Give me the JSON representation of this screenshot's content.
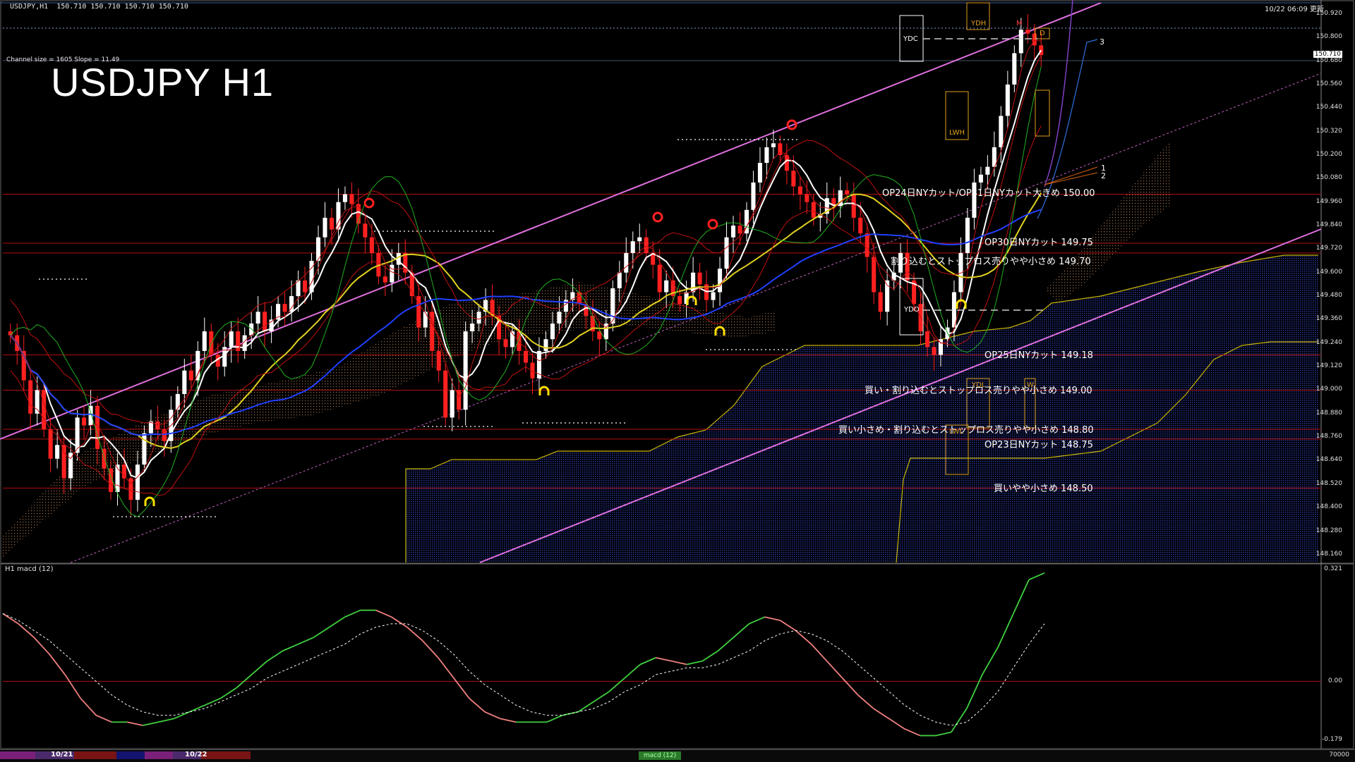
{
  "chart_data": {
    "type": "candlestick",
    "symbol": "USDJPY",
    "timeframe": "H1",
    "title": "USDJPY H1",
    "header_text": "USDJPY,H1  150.710 150.710 150.710 150.710",
    "update_time": "10/22 06:09 更新",
    "channel_info": "Channel size = 1605 Slope = 11.49",
    "current_price": "150.710",
    "current_price_sub": "150.680",
    "price_ticks": [
      "150.920",
      "150.800",
      "150.560",
      "150.440",
      "150.320",
      "150.200",
      "150.080",
      "149.960",
      "149.840",
      "149.720",
      "149.600",
      "149.480",
      "149.360",
      "149.240",
      "149.120",
      "149.000",
      "148.880",
      "148.760",
      "148.640",
      "148.520",
      "148.400",
      "148.280",
      "148.160"
    ],
    "price_range": [
      148.12,
      150.97
    ],
    "candle_closes": [
      149.28,
      149.2,
      149.05,
      148.88,
      149.0,
      148.8,
      148.65,
      148.72,
      148.55,
      148.68,
      148.86,
      148.82,
      148.92,
      148.7,
      148.6,
      148.48,
      148.62,
      148.55,
      148.44,
      148.62,
      148.78,
      148.84,
      148.8,
      148.74,
      148.9,
      148.98,
      149.1,
      149.05,
      149.2,
      149.3,
      149.18,
      149.12,
      149.22,
      149.3,
      149.2,
      149.28,
      149.34,
      149.4,
      149.3,
      149.36,
      149.44,
      149.4,
      149.48,
      149.56,
      149.5,
      149.66,
      149.78,
      149.88,
      149.82,
      149.96,
      150.0,
      149.95,
      149.85,
      149.78,
      149.7,
      149.58,
      149.55,
      149.64,
      149.7,
      149.6,
      149.48,
      149.32,
      149.4,
      149.2,
      149.1,
      148.86,
      149.0,
      148.9,
      149.3,
      149.34,
      149.4,
      149.46,
      149.38,
      149.26,
      149.22,
      149.3,
      149.2,
      149.14,
      149.06,
      149.2,
      149.26,
      149.34,
      149.4,
      149.46,
      149.5,
      149.44,
      149.38,
      149.3,
      149.26,
      149.34,
      149.52,
      149.6,
      149.7,
      149.76,
      149.78,
      149.7,
      149.64,
      149.5,
      149.56,
      149.48,
      149.44,
      149.5,
      149.6,
      149.54,
      149.46,
      149.5,
      149.62,
      149.78,
      149.84,
      149.8,
      149.92,
      150.06,
      150.16,
      150.24,
      150.26,
      150.2,
      150.12,
      150.04,
      150.0,
      149.96,
      149.88,
      149.9,
      149.98,
      149.94,
      150.02,
      150.0,
      149.88,
      149.8,
      149.68,
      149.5,
      149.4,
      149.56,
      149.6,
      149.7,
      149.56,
      149.44,
      149.3,
      149.22,
      149.18,
      149.26,
      149.32,
      149.5,
      149.7,
      149.88,
      150.06,
      150.1,
      150.14,
      150.24,
      150.4,
      150.56,
      150.72,
      150.84,
      150.82,
      150.76,
      150.71
    ],
    "levels": [
      {
        "price": 150.0,
        "label": "OP24日NYカット/OP31日NYカット大きめ 150.00"
      },
      {
        "price": 149.75,
        "label": "OP30日NYカット 149.75"
      },
      {
        "price": 149.7,
        "label": "割り込むとストップロス売りやや小さめ 149.70"
      },
      {
        "price": 149.18,
        "label": "OP25日NYカット 149.18"
      },
      {
        "price": 149.0,
        "label": "買い・割り込むとストップロス売りやや小さめ 149.00"
      },
      {
        "price": 148.8,
        "label": "買い小さめ・割り込むとストップロス売りやや小さめ 148.80"
      },
      {
        "price": 148.75,
        "label": "OP23日NYカット 148.75"
      },
      {
        "price": 148.5,
        "label": "買いやや小さめ 148.50"
      }
    ],
    "box_labels": [
      "YDC",
      "YDH",
      "YDL",
      "YDO",
      "LWH",
      "LWL",
      "W",
      "M",
      "D"
    ],
    "projection_labels": [
      "3",
      "1",
      "2"
    ],
    "macd": {
      "label": "H1  macd (12)",
      "ticks": [
        "0.321",
        "0.00",
        "-0.179"
      ],
      "range": [
        -0.19,
        0.33
      ],
      "main": [
        0.2,
        0.17,
        0.13,
        0.08,
        0.02,
        -0.05,
        -0.1,
        -0.12,
        -0.12,
        -0.13,
        -0.12,
        -0.11,
        -0.09,
        -0.07,
        -0.05,
        -0.02,
        0.02,
        0.06,
        0.09,
        0.11,
        0.13,
        0.16,
        0.19,
        0.21,
        0.21,
        0.19,
        0.16,
        0.12,
        0.07,
        0.01,
        -0.05,
        -0.09,
        -0.11,
        -0.12,
        -0.12,
        -0.12,
        -0.1,
        -0.09,
        -0.06,
        -0.03,
        0.01,
        0.05,
        0.07,
        0.06,
        0.05,
        0.06,
        0.09,
        0.13,
        0.17,
        0.19,
        0.18,
        0.15,
        0.11,
        0.06,
        0.01,
        -0.04,
        -0.08,
        -0.11,
        -0.14,
        -0.16,
        -0.16,
        -0.15,
        -0.08,
        0.02,
        0.1,
        0.2,
        0.3,
        0.32
      ],
      "signal": [
        0.2,
        0.18,
        0.15,
        0.12,
        0.08,
        0.04,
        0.0,
        -0.04,
        -0.07,
        -0.09,
        -0.1,
        -0.1,
        -0.09,
        -0.08,
        -0.06,
        -0.04,
        -0.02,
        0.01,
        0.03,
        0.05,
        0.07,
        0.09,
        0.11,
        0.14,
        0.16,
        0.17,
        0.17,
        0.15,
        0.12,
        0.08,
        0.03,
        -0.01,
        -0.04,
        -0.07,
        -0.09,
        -0.1,
        -0.1,
        -0.09,
        -0.08,
        -0.06,
        -0.03,
        -0.01,
        0.02,
        0.03,
        0.04,
        0.04,
        0.05,
        0.07,
        0.09,
        0.12,
        0.14,
        0.15,
        0.14,
        0.12,
        0.09,
        0.05,
        0.01,
        -0.03,
        -0.07,
        -0.1,
        -0.12,
        -0.13,
        -0.12,
        -0.08,
        -0.03,
        0.04,
        0.11,
        0.17
      ]
    },
    "date_labels": [
      "10/21",
      "10/22"
    ],
    "bottom_tab": "macd (12)",
    "bottom_right": "70000"
  }
}
